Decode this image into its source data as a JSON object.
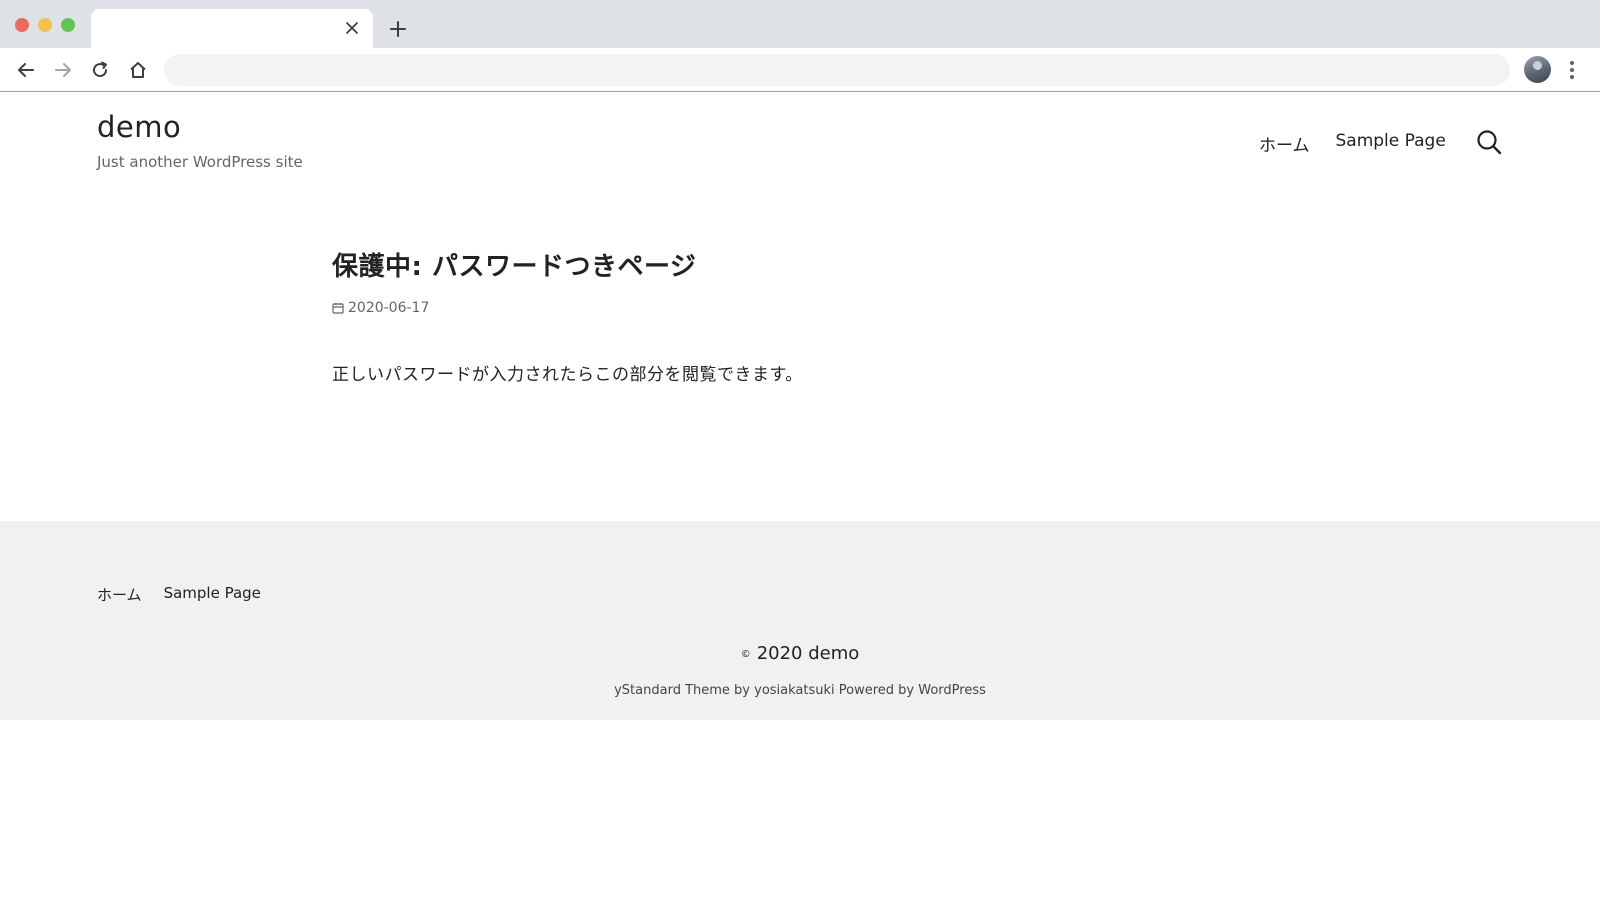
{
  "browser": {
    "tab_title": "",
    "close_glyph": "✕",
    "newtab_glyph": "+",
    "address": ""
  },
  "site": {
    "title": "demo",
    "description": "Just another WordPress site"
  },
  "nav": {
    "items": [
      {
        "label": "ホーム"
      },
      {
        "label": "Sample Page"
      }
    ]
  },
  "post": {
    "title": "保護中: パスワードつきページ",
    "date": "2020-06-17",
    "body": "正しいパスワードが入力されたらこの部分を閲覧できます。"
  },
  "footer": {
    "nav": [
      {
        "label": "ホーム"
      },
      {
        "label": "Sample Page"
      }
    ],
    "copyright_symbol": "©",
    "copyright_text": "2020 demo",
    "powered": "yStandard Theme by yosiakatsuki Powered by WordPress"
  },
  "colors": {
    "tabbar": "#dee1e6",
    "footer_bg": "#f1f1f3",
    "text": "#222222",
    "muted": "#656565"
  }
}
